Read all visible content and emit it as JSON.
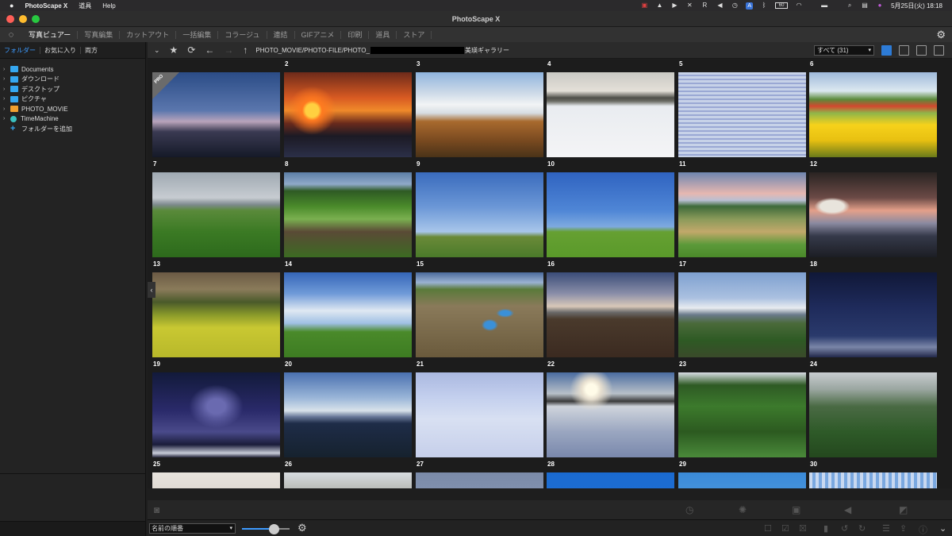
{
  "menubar": {
    "apple": "",
    "app_name": "PhotoScape X",
    "menus": [
      "道具",
      "Help"
    ],
    "chip": "A",
    "battery": "60",
    "clock": "5月25日(火)  18:18"
  },
  "window": {
    "title": "PhotoScape X"
  },
  "tabs": [
    "写真ビュアー",
    "写真編集",
    "カットアウト",
    "一括編集",
    "コラージュ",
    "連結",
    "GIFアニメ",
    "印刷",
    "道具",
    "ストア"
  ],
  "sidebar": {
    "tabs": [
      "フォルダー",
      "お気に入り",
      "両方"
    ],
    "tree": [
      {
        "label": "Documents",
        "icon": "folder-icon",
        "color": "#35a7f0"
      },
      {
        "label": "ダウンロード",
        "icon": "download-folder-icon",
        "color": "#35a7f0"
      },
      {
        "label": "デスクトップ",
        "icon": "desktop-folder-icon",
        "color": "#35a7f0"
      },
      {
        "label": "ピクチャ",
        "icon": "pictures-folder-icon",
        "color": "#35a7f0"
      },
      {
        "label": "PHOTO_MOVIE",
        "icon": "drive-icon",
        "color": "#f0a030"
      },
      {
        "label": "TimeMachine",
        "icon": "timemachine-icon",
        "color": "#3ac0c0"
      }
    ],
    "add_folder": "フォルダーを追加"
  },
  "toolbar": {
    "path_start": "PHOTO_MOVIE/PHOTO-FILE/PHOTO_",
    "path_end": "美瑛ギャラリー",
    "filter": "すべて (31)"
  },
  "gallery": {
    "pro_label": "PRO",
    "thumbnails": [
      {
        "num": "",
        "bg": "linear-gradient(180deg,#2b4c86 0%,#5a76ad 45%,#b9a4bb 58%,#3a3a52 70%,#151a28 100%)"
      },
      {
        "num": "2",
        "bg": "radial-gradient(circle at 22% 45%,#ffd040 0 6%,#ff7a20 9%,transparent 22%),linear-gradient(180deg,#6d2a1a 0%,#d85a22 30%,#f08a2a 45%,#6a2a1c 60%,#1c1a24 75%,#2b2f48 100%)"
      },
      {
        "num": "3",
        "bg": "linear-gradient(180deg,#8fb4de 0%,#cfdbe8 25%,#f2f4f5 38%,#d7dde3 48%,#a86a2e 58%,#7a4a20 80%,#4a3318 100%)"
      },
      {
        "num": "4",
        "bg": "linear-gradient(180deg,#c9c9c4 0%,#e4e0d8 22%,#50504a 30%,#6a6a62 34%,#e9ecf0 40%,#f4f4f6 100%)"
      },
      {
        "num": "5",
        "bg": "repeating-linear-gradient(180deg,#c7d2e8 0 3px,#9aa8d4 3px 5px),linear-gradient(180deg,#e4e8ee 0%,#cfd7e2 100%)"
      },
      {
        "num": "6",
        "bg": "linear-gradient(180deg,#9fb9da 0%,#dce8f0 22%,#5a8a3a 32%,#d3482f 40%,#8fb54a 48%,#f6d21b 62%,#e8c011 80%,#6a7a1a 100%)"
      },
      {
        "num": "7",
        "bg": "linear-gradient(180deg,#9fa9b2 0%,#c7ccd1 30%,#7e8a8e 38%,#5a8a3a 45%,#3b7a24 70%,#2d6a1c 100%)"
      },
      {
        "num": "8",
        "bg": "linear-gradient(180deg,#5c7ea6 0%,#8fa9c8 14%,#2e5a24 22%,#4a8a2a 40%,#7ab050 55%,#5a4a36 70%,#3c6a22 100%)"
      },
      {
        "num": "9",
        "bg": "linear-gradient(180deg,#3a6bbd 0%,#6a96d6 40%,#a8c6ea 70%,#6a8a38 76%,#4a7a2a 100%)"
      },
      {
        "num": "10",
        "bg": "linear-gradient(180deg,#2f63c0 0%,#4f86d6 45%,#7eaae0 64%,#66a032 70%,#5a9a2a 100%)"
      },
      {
        "num": "11",
        "bg": "linear-gradient(180deg,#6e86b0 0%,#e6b7b0 25%,#b8bfd2 33%,#3e6a3a 40%,#8a9a5a 55%,#c2a86a 70%,#5c9a3a 85%,#4a8a2a 100%)"
      },
      {
        "num": "12",
        "bg": "radial-gradient(ellipse at 18% 40%,#e8e4dc 0 8%,transparent 12%),linear-gradient(180deg,#2a2422 0%,#6b4a46 30%,#e4a08a 45%,#8a8aa0 60%,#35394a 75%,#1c1e24 100%)"
      },
      {
        "num": "13",
        "bg": "linear-gradient(180deg,#6b5a44 0%,#8a7b5a 20%,#4a5a2a 35%,#8a9a2a 50%,#c9c832 65%,#b8b82a 100%)"
      },
      {
        "num": "14",
        "bg": "linear-gradient(180deg,#3566b8 0%,#6f9ad8 25%,#dfe8f2 45%,#9fc0e4 60%,#4a8a2a 70%,#3d7c22 100%)"
      },
      {
        "num": "15",
        "bg": "radial-gradient(ellipse at 58% 62%,#3a90d8 0 5%,transparent 8%),radial-gradient(ellipse at 70% 48%,#3a90d8 0 4%,transparent 7%),linear-gradient(180deg,#4b6a9b 0%,#9ab2d2 12%,#5a7a3a 20%,#8a7a5a 40%,#6a5a3c 100%)"
      },
      {
        "num": "16",
        "bg": "linear-gradient(180deg,#3a4c78 0%,#8a8ea8 25%,#d8c8b8 40%,#6a6a6a 47%,#4a3a2c 55%,#3b2a20 100%)"
      },
      {
        "num": "17",
        "bg": "linear-gradient(180deg,#7ea0d0 0%,#aac0e0 30%,#e8ecf0 42%,#6a7a8a 50%,#4a6a3a 60%,#2e5a24 80%,#3a4a2a 100%)"
      },
      {
        "num": "18",
        "bg": "linear-gradient(180deg,#101838 0%,#1e2a5a 40%,#2a3a6c 75%,#7a86a8 88%,#22284a 100%)"
      },
      {
        "num": "19",
        "bg": "radial-gradient(ellipse at 50% 40%,#6a6ab0 0 10%,transparent 30%),linear-gradient(180deg,#121a3a 0%,#2a2a6a 45%,#4a4a8a 70%,#1a1c3a 85%,#c8ccd8 95%,#2a2a40 100%)"
      },
      {
        "num": "20",
        "bg": "linear-gradient(180deg,#4a70b0 0%,#9ab6d8 30%,#d8e2ea 45%,#6a7a9a 52%,#1e2c48 60%,#16222e 100%)"
      },
      {
        "num": "21",
        "bg": "linear-gradient(180deg,#aab8e0 0%,#c4d0ee 30%,#d8e0f2 55%,#c6cfea 100%)"
      },
      {
        "num": "22",
        "bg": "radial-gradient(circle at 35% 20%,#fffbe8 0 5%,#e8e0d0 9%,transparent 20%),linear-gradient(180deg,#4a6ca0 0%,#b8c0c8 25%,#3a3a3a 34%,#cfd4dc 40%,#9aa6c0 70%,#7a88ac 100%)"
      },
      {
        "num": "23",
        "bg": "linear-gradient(180deg,#d8dce4 0%,#2e5a24 15%,#3c7a2c 40%,#2c5a20 70%,#4a8a3a 100%)"
      },
      {
        "num": "24",
        "bg": "linear-gradient(180deg,#c8ccd0 0%,#9aa6a0 20%,#4a6a44 40%,#2e5a28 70%,#24481e 100%)"
      },
      {
        "num": "25",
        "bg": "linear-gradient(180deg,#e8e4de 0%,#d8d0c8 40%,#6a5a4a 100%)"
      },
      {
        "num": "26",
        "bg": "linear-gradient(180deg,#d8dce0 0%,#8a8a7a 50%,#6a7a3a 100%)"
      },
      {
        "num": "27",
        "bg": "linear-gradient(180deg,#7a8aa8 0%,#9aaac8 100%)"
      },
      {
        "num": "28",
        "bg": "linear-gradient(180deg,#1a6ad0 0%,#2a7ad8 100%)"
      },
      {
        "num": "29",
        "bg": "linear-gradient(180deg,#3a8ad8 0%,#6ab0e8 100%)"
      },
      {
        "num": "30",
        "bg": "repeating-linear-gradient(90deg,#c8d8f0 0 4px,#7aa8e0 4px 8px)"
      }
    ]
  },
  "bottom": {
    "sort": "名前の順番",
    "zoom_fraction": 0.66
  }
}
